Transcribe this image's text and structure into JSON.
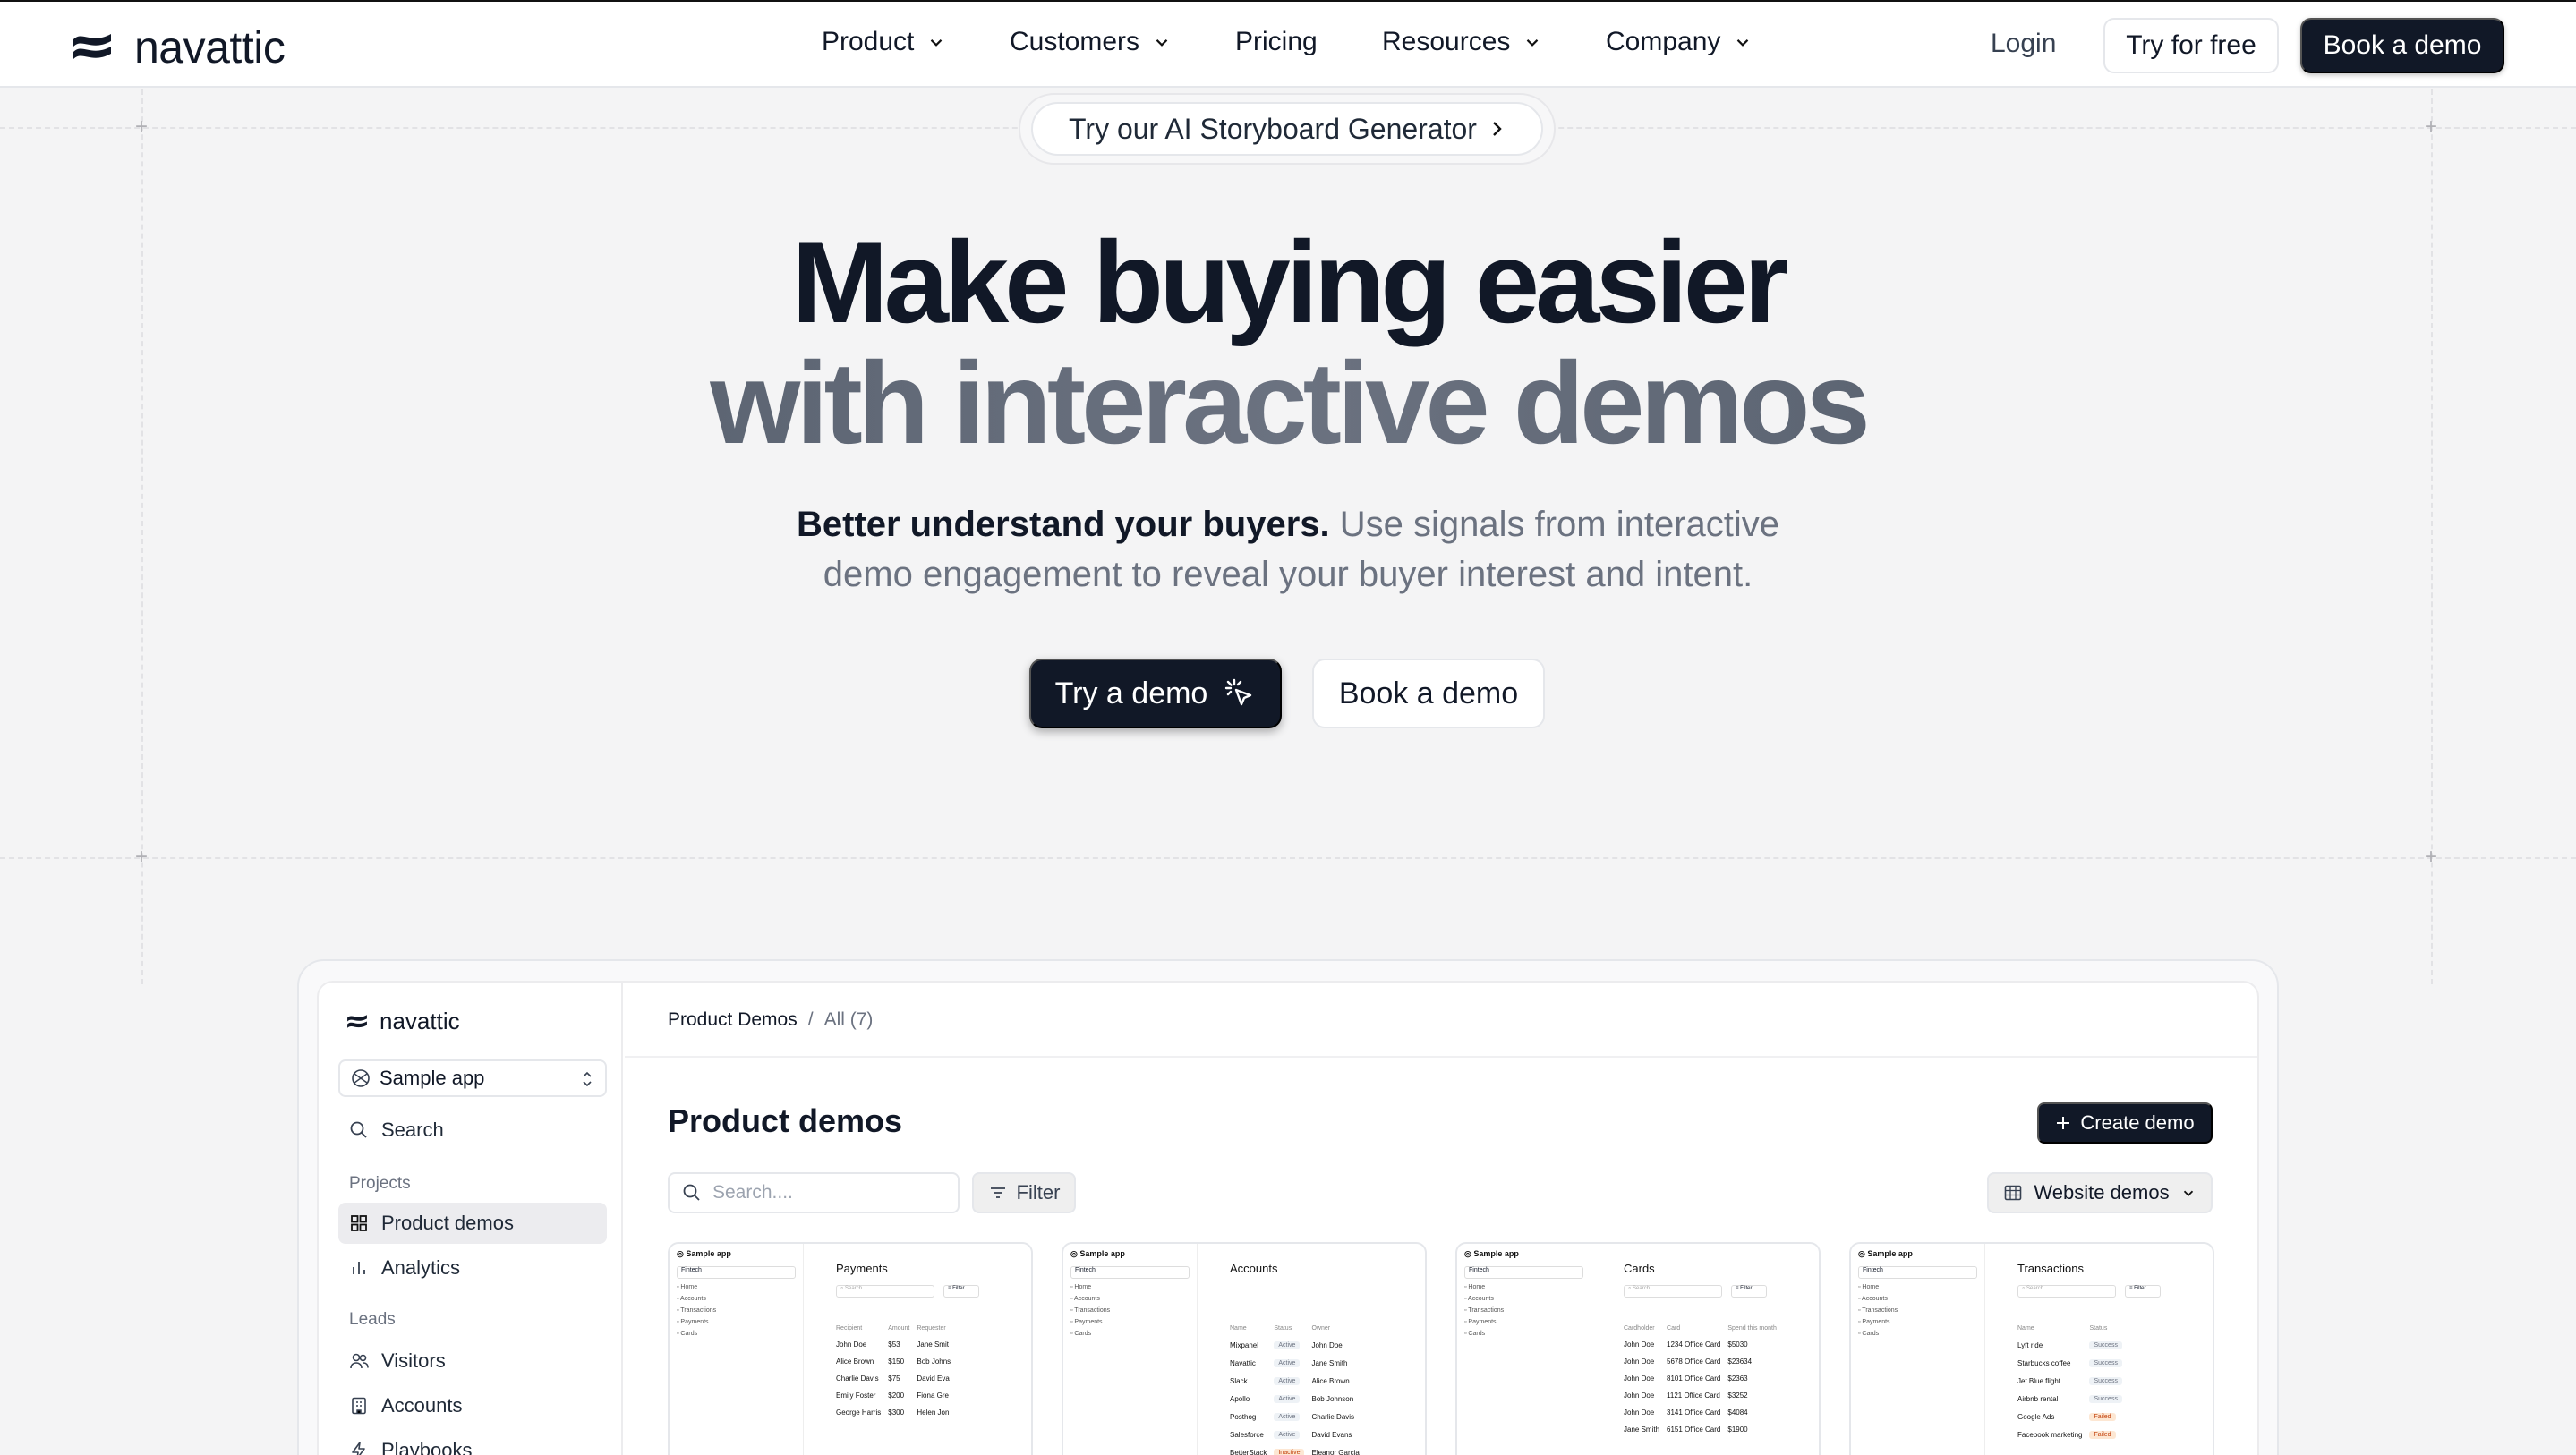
{
  "brand": {
    "name": "navattic"
  },
  "nav": {
    "items": [
      {
        "label": "Product",
        "has_menu": true
      },
      {
        "label": "Customers",
        "has_menu": true
      },
      {
        "label": "Pricing",
        "has_menu": false
      },
      {
        "label": "Resources",
        "has_menu": true
      },
      {
        "label": "Company",
        "has_menu": true
      }
    ],
    "login": "Login",
    "try_free": "Try for free",
    "book_demo": "Book a demo"
  },
  "announcement": {
    "label": "Try our AI Storyboard Generator"
  },
  "hero": {
    "line1": "Make buying easier",
    "line2": "with interactive demos",
    "sub_bold": "Better understand your buyers.",
    "sub_rest_1": "Use signals from interactive",
    "sub_rest_2": "demo engagement to reveal your buyer interest and intent.",
    "cta_primary": "Try a demo",
    "cta_secondary": "Book a demo"
  },
  "app": {
    "brand": "navattic",
    "workspace": "Sample app",
    "search": "Search",
    "section_projects": "Projects",
    "product_demos": "Product demos",
    "analytics": "Analytics",
    "section_leads": "Leads",
    "visitors": "Visitors",
    "accounts": "Accounts",
    "playbooks": "Playbooks",
    "breadcrumb": {
      "root": "Product Demos",
      "sep": "/",
      "current": "All (7)"
    },
    "title": "Product demos",
    "create_label": "Create demo",
    "search_placeholder": "Search....",
    "filter_label": "Filter",
    "view_label": "Website demos"
  },
  "cards": [
    {
      "app": "Sample app",
      "workspace": "Fintech",
      "nav": [
        "Home",
        "Accounts",
        "Transactions",
        "Payments",
        "Cards"
      ],
      "title": "Payments",
      "search": "Search",
      "filter": "Filter",
      "headers": [
        "Recipient",
        "Amount",
        "Requester"
      ],
      "rows": [
        [
          "John Doe",
          "$53",
          "Jane Smit"
        ],
        [
          "Alice Brown",
          "$150",
          "Bob Johns"
        ],
        [
          "Charlie Davis",
          "$75",
          "David Eva"
        ],
        [
          "Emily Foster",
          "$200",
          "Fiona Gre"
        ],
        [
          "George Harris",
          "$300",
          "Helen Jon"
        ]
      ]
    },
    {
      "app": "Sample app",
      "workspace": "Fintech",
      "nav": [
        "Home",
        "Accounts",
        "Transactions",
        "Payments",
        "Cards"
      ],
      "title": "Accounts",
      "search": "",
      "filter": "",
      "headers": [
        "Name",
        "Status",
        "Owner"
      ],
      "rows": [
        [
          "Mixpanel",
          "Active",
          "John Doe"
        ],
        [
          "Navattic",
          "Active",
          "Jane Smith"
        ],
        [
          "Slack",
          "Active",
          "Alice Brown"
        ],
        [
          "Apollo",
          "Active",
          "Bob Johnson"
        ],
        [
          "Posthog",
          "Active",
          "Charlie Davis"
        ],
        [
          "Salesforce",
          "Active",
          "David Evans"
        ],
        [
          "BetterStack",
          "Inactive",
          "Eleanor Garcia"
        ]
      ]
    },
    {
      "app": "Sample app",
      "workspace": "Fintech",
      "nav": [
        "Home",
        "Accounts",
        "Transactions",
        "Payments",
        "Cards"
      ],
      "title": "Cards",
      "search": "Search",
      "filter": "Filter",
      "headers": [
        "Cardholder",
        "Card",
        "Spend this month"
      ],
      "rows": [
        [
          "John Doe",
          "1234 Office Card",
          "$5030"
        ],
        [
          "John Doe",
          "5678 Office Card",
          "$23634"
        ],
        [
          "John Doe",
          "8101 Office Card",
          "$2363"
        ],
        [
          "John Doe",
          "1121 Office Card",
          "$3252"
        ],
        [
          "John Doe",
          "3141 Office Card",
          "$4084"
        ],
        [
          "Jane Smith",
          "6151 Office Card",
          "$1900"
        ]
      ]
    },
    {
      "app": "Sample app",
      "workspace": "Fintech",
      "nav": [
        "Home",
        "Accounts",
        "Transactions",
        "Payments",
        "Cards"
      ],
      "title": "Transactions",
      "search": "Search",
      "filter": "Filter",
      "headers": [
        "Name",
        "Status"
      ],
      "rows": [
        [
          "Lyft ride",
          "Success"
        ],
        [
          "Starbucks coffee",
          "Success"
        ],
        [
          "Jet Blue flight",
          "Success"
        ],
        [
          "Airbnb rental",
          "Success"
        ],
        [
          "Google Ads",
          "Failed"
        ],
        [
          "Facebook marketing",
          "Failed"
        ]
      ]
    }
  ]
}
